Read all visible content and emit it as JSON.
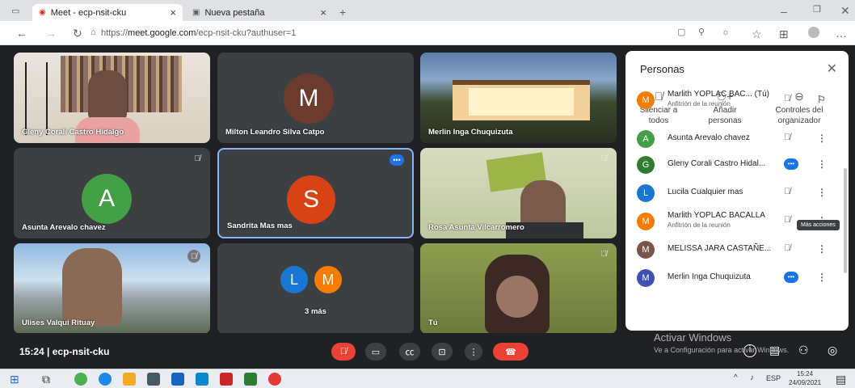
{
  "browser": {
    "tabs": [
      {
        "label": "Meet - ecp-nsit-cku"
      },
      {
        "label": "Nueva pestaña"
      }
    ],
    "url_prefix": "https://",
    "url_host": "meet.google.com",
    "url_path": "/ecp-nsit-cku?authuser=1"
  },
  "tiles": [
    {
      "name": "Gleny Corali Castro Hidalgo"
    },
    {
      "name": "Milton Leandro Silva Catpo",
      "initial": "M",
      "color": "#6d3a2e"
    },
    {
      "name": "Merlin Inga Chuquizuta"
    },
    {
      "name": "Asunta Arevalo chavez",
      "initial": "A",
      "color": "#43a047"
    },
    {
      "name": "Sandrita Mas mas",
      "initial": "S",
      "color": "#d84315"
    },
    {
      "name": "Rosa Asunta Vilcarromero"
    },
    {
      "name": "Ulises Valqui Rituay"
    },
    {
      "name": "3 más",
      "initials": [
        "L",
        "M"
      ]
    },
    {
      "name": "Tú"
    }
  ],
  "panel": {
    "title": "Personas",
    "actions": [
      {
        "line1": "Silenciar a",
        "line2": "todos"
      },
      {
        "line1": "Añadir",
        "line2": "personas"
      },
      {
        "line1": "Controles del",
        "line2": "organizador"
      }
    ],
    "people": [
      {
        "initial": "M",
        "color": "#f57c00",
        "name": "Marlith YOPLAC BAC... (Tú)",
        "sub": "Anfitrión de la reunión"
      },
      {
        "initial": "A",
        "color": "#43a047",
        "name": "Asunta Arevalo chavez",
        "sub": ""
      },
      {
        "initial": "G",
        "color": "#2e7d32",
        "name": "Gleny Corali Castro Hidal...",
        "sub": ""
      },
      {
        "initial": "L",
        "color": "#1976d2",
        "name": "Lucila Cualquier mas",
        "sub": ""
      },
      {
        "initial": "M",
        "color": "#f57c00",
        "name": "Marlith YOPLAC BACALLA",
        "sub": "Anfitrión de la reunión"
      },
      {
        "initial": "M",
        "color": "#795548",
        "name": "MELISSA JARA CASTAÑE...",
        "sub": ""
      },
      {
        "initial": "M",
        "color": "#3f51b5",
        "name": "Merlin Inga Chuquizuta",
        "sub": ""
      }
    ],
    "tooltip": "Más acciones"
  },
  "bottom": {
    "time": "15:24",
    "code": "ecp-nsit-cku"
  },
  "watermark": {
    "line1": "Activar Windows",
    "line2": "Ve a Configuración para activar Windows."
  },
  "taskbar": {
    "lang": "ESP",
    "time": "15:24",
    "date": "24/09/2021"
  }
}
